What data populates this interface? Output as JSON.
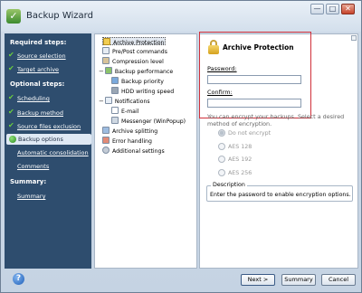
{
  "window": {
    "title": "Backup Wizard",
    "minimize": "—",
    "maximize": "□",
    "close": "✕"
  },
  "sidebar": {
    "required_heading": "Required steps:",
    "required": [
      "Source selection",
      "Target archive"
    ],
    "optional_heading": "Optional steps:",
    "optional": [
      "Scheduling",
      "Backup method",
      "Source files exclusion"
    ],
    "active": "Backup options",
    "suboptions": [
      "Automatic consolidation",
      "Comments"
    ],
    "summary_heading": "Summary:",
    "summary_link": "Summary"
  },
  "tree": {
    "items": [
      {
        "label": "Archive Protection",
        "selected": true
      },
      {
        "label": "Pre/Post commands"
      },
      {
        "label": "Compression level"
      },
      {
        "label": "Backup performance"
      },
      {
        "label": "Backup priority"
      },
      {
        "label": "HDD writing speed"
      },
      {
        "label": "Notifications"
      },
      {
        "label": "E-mail"
      },
      {
        "label": "Messenger (WinPopup)"
      },
      {
        "label": "Archive splitting"
      },
      {
        "label": "Error handling"
      },
      {
        "label": "Additional settings"
      }
    ]
  },
  "panel": {
    "title": "Archive Protection",
    "password_label": "Password:",
    "confirm_label": "Confirm:",
    "info": "You can encrypt your backups. Select a desired method of encryption.",
    "options": [
      "Do not encrypt",
      "AES 128",
      "AES 192",
      "AES 256"
    ],
    "selected_option": "Do not encrypt",
    "description_heading": "Description",
    "description_text": "Enter the password to enable encryption options."
  },
  "buttons": {
    "next": "Next >",
    "summary": "Summary",
    "cancel": "Cancel",
    "help": "?"
  }
}
